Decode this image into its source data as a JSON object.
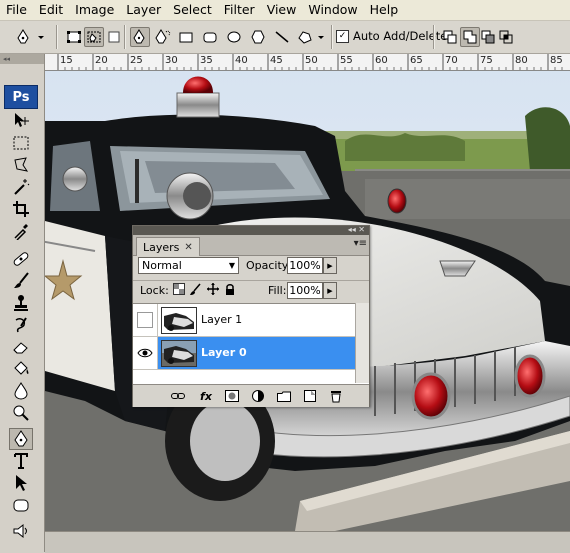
{
  "menu": [
    "File",
    "Edit",
    "Image",
    "Layer",
    "Select",
    "Filter",
    "View",
    "Window",
    "Help"
  ],
  "options_bar": {
    "tool_icons": [
      "pen-tool-icon",
      "shape-layers-icon",
      "paths-icon",
      "fill-pixels-icon",
      "pen-icon",
      "freeform-pen-icon",
      "rectangle-icon",
      "rounded-rectangle-icon",
      "ellipse-icon",
      "polygon-icon",
      "line-icon",
      "custom-shape-icon"
    ],
    "auto_add_delete_label": "Auto Add/Delete",
    "auto_add_delete_checked": true
  },
  "toolbox": {
    "logo": "Ps",
    "tools": [
      "move-tool-icon",
      "marquee-tool-icon",
      "lasso-tool-icon",
      "magic-wand-icon",
      "crop-tool-icon",
      "eyedropper-icon",
      "healing-brush-icon",
      "brush-tool-icon",
      "clone-stamp-icon",
      "history-brush-icon",
      "eraser-tool-icon",
      "paint-bucket-icon",
      "blur-tool-icon",
      "dodge-tool-icon",
      "pen-tool-icon",
      "type-tool-icon",
      "path-selection-icon",
      "shape-tool-icon",
      "notes-tool-icon"
    ]
  },
  "ruler": {
    "labels": [
      "15",
      "20",
      "25",
      "30",
      "35",
      "40",
      "45",
      "50",
      "55",
      "60",
      "65",
      "70",
      "75",
      "80",
      "85"
    ]
  },
  "layers_panel": {
    "tab_title": "Layers",
    "blend_mode": "Normal",
    "opacity_label": "Opacity:",
    "opacity_value": "100%",
    "lock_label": "Lock:",
    "fill_label": "Fill:",
    "fill_value": "100%",
    "layers": [
      {
        "name": "Layer 1",
        "visible": false,
        "selected": false
      },
      {
        "name": "Layer 0",
        "visible": true,
        "selected": true
      }
    ],
    "selection_color": "#3a8ff0"
  }
}
